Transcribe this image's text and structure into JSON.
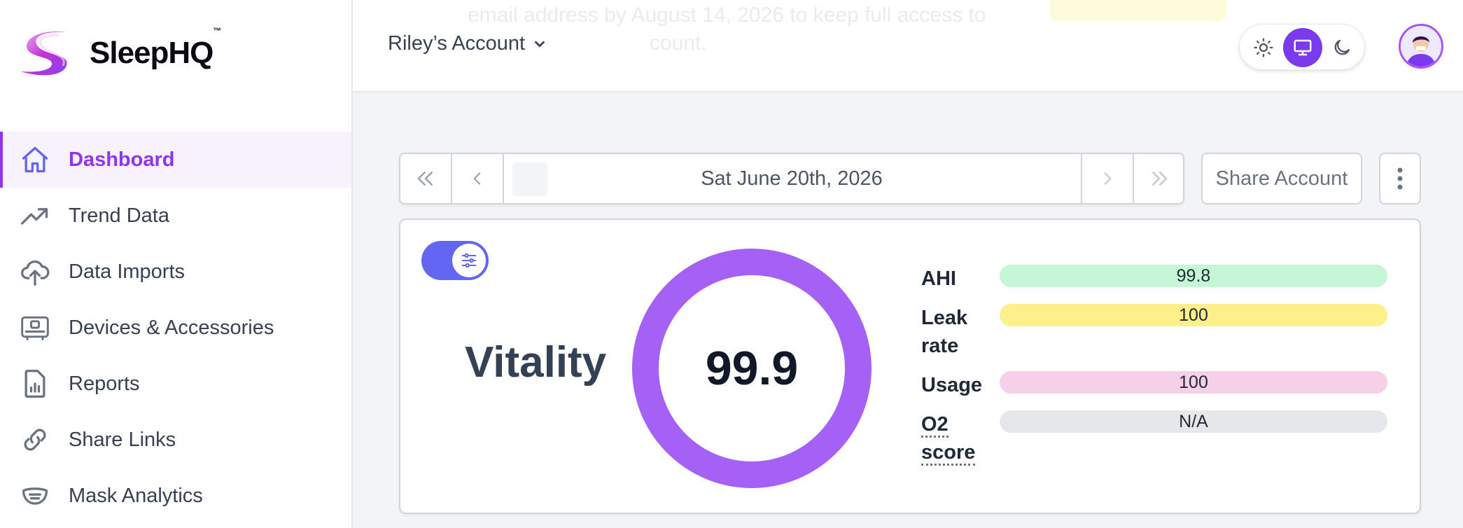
{
  "app": {
    "name": "SleepHQ",
    "trademark": "™"
  },
  "sidebar": {
    "items": [
      {
        "label": "Dashboard",
        "icon": "home-icon",
        "active": true
      },
      {
        "label": "Trend Data",
        "icon": "trend-icon"
      },
      {
        "label": "Data Imports",
        "icon": "cloud-upload-icon"
      },
      {
        "label": "Devices & Accessories",
        "icon": "device-icon"
      },
      {
        "label": "Reports",
        "icon": "report-icon"
      },
      {
        "label": "Share Links",
        "icon": "link-icon"
      },
      {
        "label": "Mask Analytics",
        "icon": "mask-icon"
      }
    ]
  },
  "header": {
    "account_label": "Riley’s Account",
    "banner_line1": "email address by August 14, 2026 to keep full access to",
    "banner_line2": "count.",
    "theme_selected": "system"
  },
  "datenav": {
    "date": "Sat June 20th, 2026",
    "share_label": "Share Account"
  },
  "vitality": {
    "label": "Vitality",
    "score": "99.9",
    "ring_color": "#a561f6"
  },
  "metrics": [
    {
      "label": "AHI",
      "value": "99.8",
      "color": "#c6f6d5"
    },
    {
      "label": "Leak rate",
      "value": "100",
      "color": "#fdf08b"
    },
    {
      "label": "Usage",
      "value": "100",
      "color": "#f6d0e6"
    },
    {
      "label": "O2 score",
      "value": "N/A",
      "color": "#e5e7eb"
    }
  ],
  "colors": {
    "accent": "#9333ea",
    "toggle": "#6366f1"
  }
}
